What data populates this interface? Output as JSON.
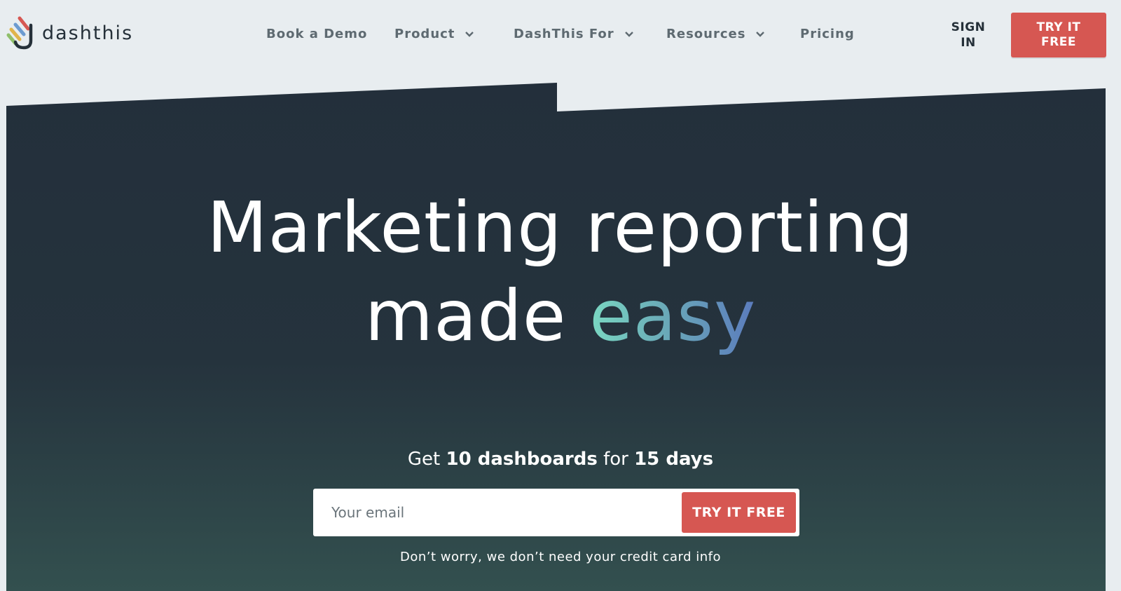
{
  "brand": {
    "name": "dashthis"
  },
  "nav": {
    "items": [
      {
        "label": "Book a Demo",
        "dropdown": false
      },
      {
        "label": "Product",
        "dropdown": true
      },
      {
        "label": "DashThis For",
        "dropdown": true
      },
      {
        "label": "Resources",
        "dropdown": true
      },
      {
        "label": "Pricing",
        "dropdown": false
      }
    ],
    "sign_in": "SIGN IN",
    "try_free": "TRY IT FREE"
  },
  "hero": {
    "headline_line1": "Marketing reporting",
    "headline_line2_prefix": "made",
    "headline_highlight": "easy",
    "offer_prefix": "Get",
    "offer_dashboards": "10 dashboards",
    "offer_middle": "for",
    "offer_days": "15 days",
    "email_placeholder": "Your email",
    "submit_label": "TRY IT FREE",
    "note": "Don’t worry, we don’t need your credit card info"
  },
  "colors": {
    "accent_red": "#d65752",
    "hero_dark": "#232f3b",
    "hero_bottom": "#33504f",
    "page_bg": "#e8edf0"
  }
}
